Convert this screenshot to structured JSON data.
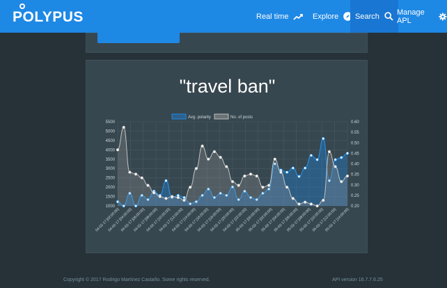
{
  "brand": {
    "name": "POLYPUS"
  },
  "nav": {
    "items": [
      {
        "label": "Real time",
        "icon": "trending-up-icon"
      },
      {
        "label": "Explore",
        "icon": "compass-icon"
      },
      {
        "label": "Search",
        "icon": "search-icon",
        "active": true
      },
      {
        "label": "Manage APL",
        "icon": "gear-icon"
      }
    ]
  },
  "query": {
    "title": "\"travel ban\""
  },
  "chart_data": {
    "type": "line",
    "legend": [
      "Avg. polarity",
      "No. of posts"
    ],
    "legend_position": "top",
    "y_left": {
      "ticks": [
        "1000",
        "1500",
        "2000",
        "2500",
        "3000",
        "3500",
        "4000",
        "4500",
        "5000",
        "5500"
      ],
      "range": [
        1000,
        5500
      ]
    },
    "y_right": {
      "ticks": [
        "0.20",
        "0.25",
        "0.30",
        "0.35",
        "0.40",
        "0.45",
        "0.50",
        "0.55",
        "0.60"
      ],
      "range": [
        0.2,
        0.6
      ]
    },
    "x_labels": [
      "04-02-17 [02:00:00]",
      "04-02-17 [04:00:00]",
      "04-02-17 [06:00:00]",
      "04-02-17 [08:00:00]",
      "04-02-17 [10:00:00]",
      "04-02-17 [12:00:00]",
      "04-02-17 [14:00:00]",
      "04-02-17 [16:00:00]",
      "04-02-17 [18:00:00]",
      "04-02-17 [20:00:00]",
      "04-02-17 [22:00:00]",
      "05-02-17 [00:00:00]",
      "05-02-17 [02:00:00]",
      "05-02-17 [04:00:00]",
      "05-02-17 [06:00:00]",
      "05-02-17 [08:00:00]",
      "05-02-17 [10:00:00]",
      "05-02-17 [12:00:00]",
      "05-02-17 [14:00:00]"
    ],
    "series": [
      {
        "name": "Avg. polarity",
        "axis": "right",
        "color": "#1e88e5",
        "values": [
          0.22,
          0.2,
          0.26,
          0.2,
          0.25,
          0.23,
          0.27,
          0.25,
          0.32,
          0.24,
          0.25,
          0.24,
          0.21,
          0.22,
          0.25,
          0.28,
          0.24,
          0.26,
          0.25,
          0.29,
          0.23,
          0.27,
          0.24,
          0.23,
          0.26,
          0.28,
          0.4,
          0.37,
          0.36,
          0.38,
          0.34,
          0.38,
          0.44,
          0.42,
          0.52,
          0.32,
          0.42,
          0.43,
          0.45
        ]
      },
      {
        "name": "No. of posts",
        "axis": "left",
        "color": "#b0b0b0",
        "values": [
          4000,
          5200,
          2800,
          2700,
          2500,
          2100,
          1700,
          1500,
          1400,
          1500,
          1450,
          1300,
          2000,
          3000,
          4200,
          3500,
          3900,
          3600,
          3100,
          2300,
          2100,
          2600,
          2700,
          2600,
          2000,
          2100,
          3500,
          2800,
          2000,
          1400,
          1100,
          1200,
          1100,
          1000,
          1300,
          3900,
          3100,
          2300,
          2600
        ]
      }
    ],
    "grid": true
  },
  "footer": {
    "copyright": "Copyright © 2017 Rodrigo Martínez Castaño. Some rights reserved.",
    "version": "API version 16.7.7.6.25"
  }
}
